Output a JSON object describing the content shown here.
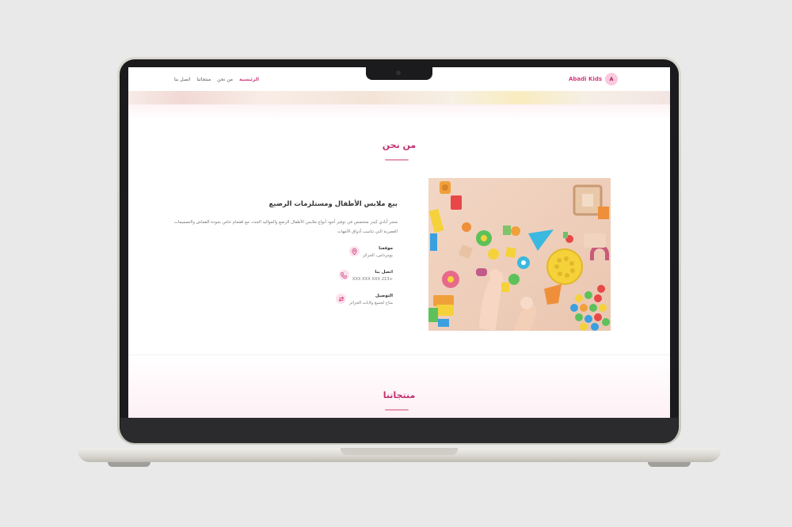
{
  "nav": {
    "links": [
      "الرئيسية",
      "من نحن",
      "منتجاتنا",
      "اتصل بنا"
    ],
    "active_index": 0,
    "brand_name": "Abadi Kids",
    "brand_letter": "A"
  },
  "about": {
    "title": "من نحن",
    "heading": "بيع ملابس الأطفال ومستلزمات الرضيع",
    "description": "متجر أبادي كيدز متخصص في توفير أجود أنواع ملابس الأطفال الرضع والمواليد الجدد، مع اهتمام خاص بجودة القماش والتصميمات العصرية التي تناسب أذواق الأمهات",
    "items": [
      {
        "icon": "location-icon",
        "title": "موقعنا",
        "value": "بومرداس، الجزائر"
      },
      {
        "icon": "phone-icon",
        "title": "اتصل بنا",
        "value": "+213 XXX XXX XXX"
      },
      {
        "icon": "delivery-icon",
        "title": "التوصيل",
        "value": "متاح لجميع ولايات الجزائر"
      }
    ],
    "image_alt": "ألعاب أطفال ملونة"
  },
  "products": {
    "title": "منتجاتنا"
  },
  "colors": {
    "accent": "#d23b7e",
    "accent_light": "#fbe1ec",
    "text": "#333333"
  }
}
